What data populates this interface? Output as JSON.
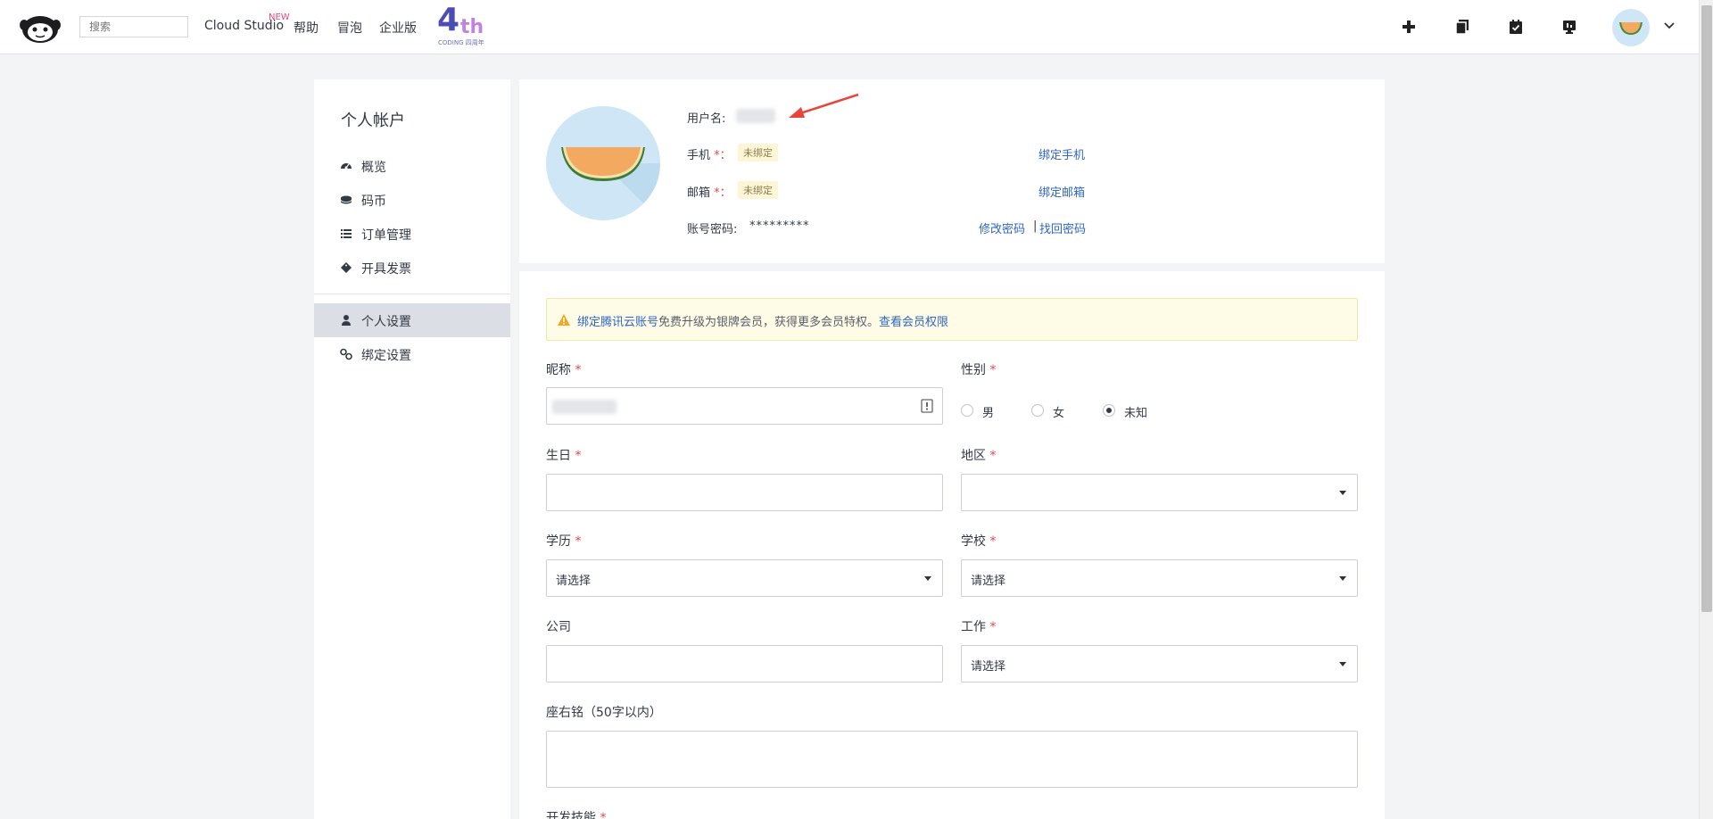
{
  "header": {
    "search_placeholder": "搜索",
    "nav": {
      "cloud_studio": "Cloud Studio",
      "new_badge": "NEW",
      "help": "帮助",
      "bubble": "冒泡",
      "enterprise": "企业版"
    },
    "anniversary": {
      "number": "4",
      "suffix": "th",
      "subtitle": "CODING 四周年"
    },
    "icons": [
      "plus-icon",
      "copy-icon",
      "calendar-check-icon",
      "monitor-icon",
      "avatar",
      "chevron-down-icon"
    ]
  },
  "sidebar": {
    "title": "个人帐户",
    "items": [
      {
        "label": "概览",
        "icon": "dashboard-icon"
      },
      {
        "label": "码币",
        "icon": "coins-icon"
      },
      {
        "label": "订单管理",
        "icon": "list-icon"
      },
      {
        "label": "开具发票",
        "icon": "ticket-icon"
      },
      {
        "label": "个人设置",
        "icon": "user-icon",
        "active": true
      },
      {
        "label": "绑定设置",
        "icon": "link-icon"
      }
    ]
  },
  "profile": {
    "username_label": "用户名:",
    "phone_label": "手机",
    "email_label": "邮箱",
    "required_colon": "*：",
    "unbound": "未绑定",
    "password_label": "账号密码:",
    "password_mask": "*********",
    "bind_phone": "绑定手机",
    "bind_email": "绑定邮箱",
    "change_password": "修改密码",
    "separator": "|",
    "recover_password": "找回密码"
  },
  "notice": {
    "link1": "绑定腾讯云账号",
    "text": "免费升级为银牌会员，获得更多会员特权。",
    "link2": "查看会员权限"
  },
  "form": {
    "required_mark": "*",
    "nickname_label": "昵称",
    "gender_label": "性别",
    "gender_options": [
      {
        "label": "男",
        "checked": false
      },
      {
        "label": "女",
        "checked": false
      },
      {
        "label": "未知",
        "checked": true
      }
    ],
    "birthday_label": "生日",
    "region_label": "地区",
    "education_label": "学历",
    "education_value": "请选择",
    "school_label": "学校",
    "school_value": "请选择",
    "company_label": "公司",
    "job_label": "工作",
    "job_value": "请选择",
    "motto_label": "座右铭（50字以内）",
    "skills_label": "开发技能"
  },
  "colors": {
    "link": "#2f66c4",
    "required": "#e84a4a",
    "active_bg": "#dbdfe5",
    "notice_bg": "#fefbe6",
    "arrow": "#e8463c"
  }
}
